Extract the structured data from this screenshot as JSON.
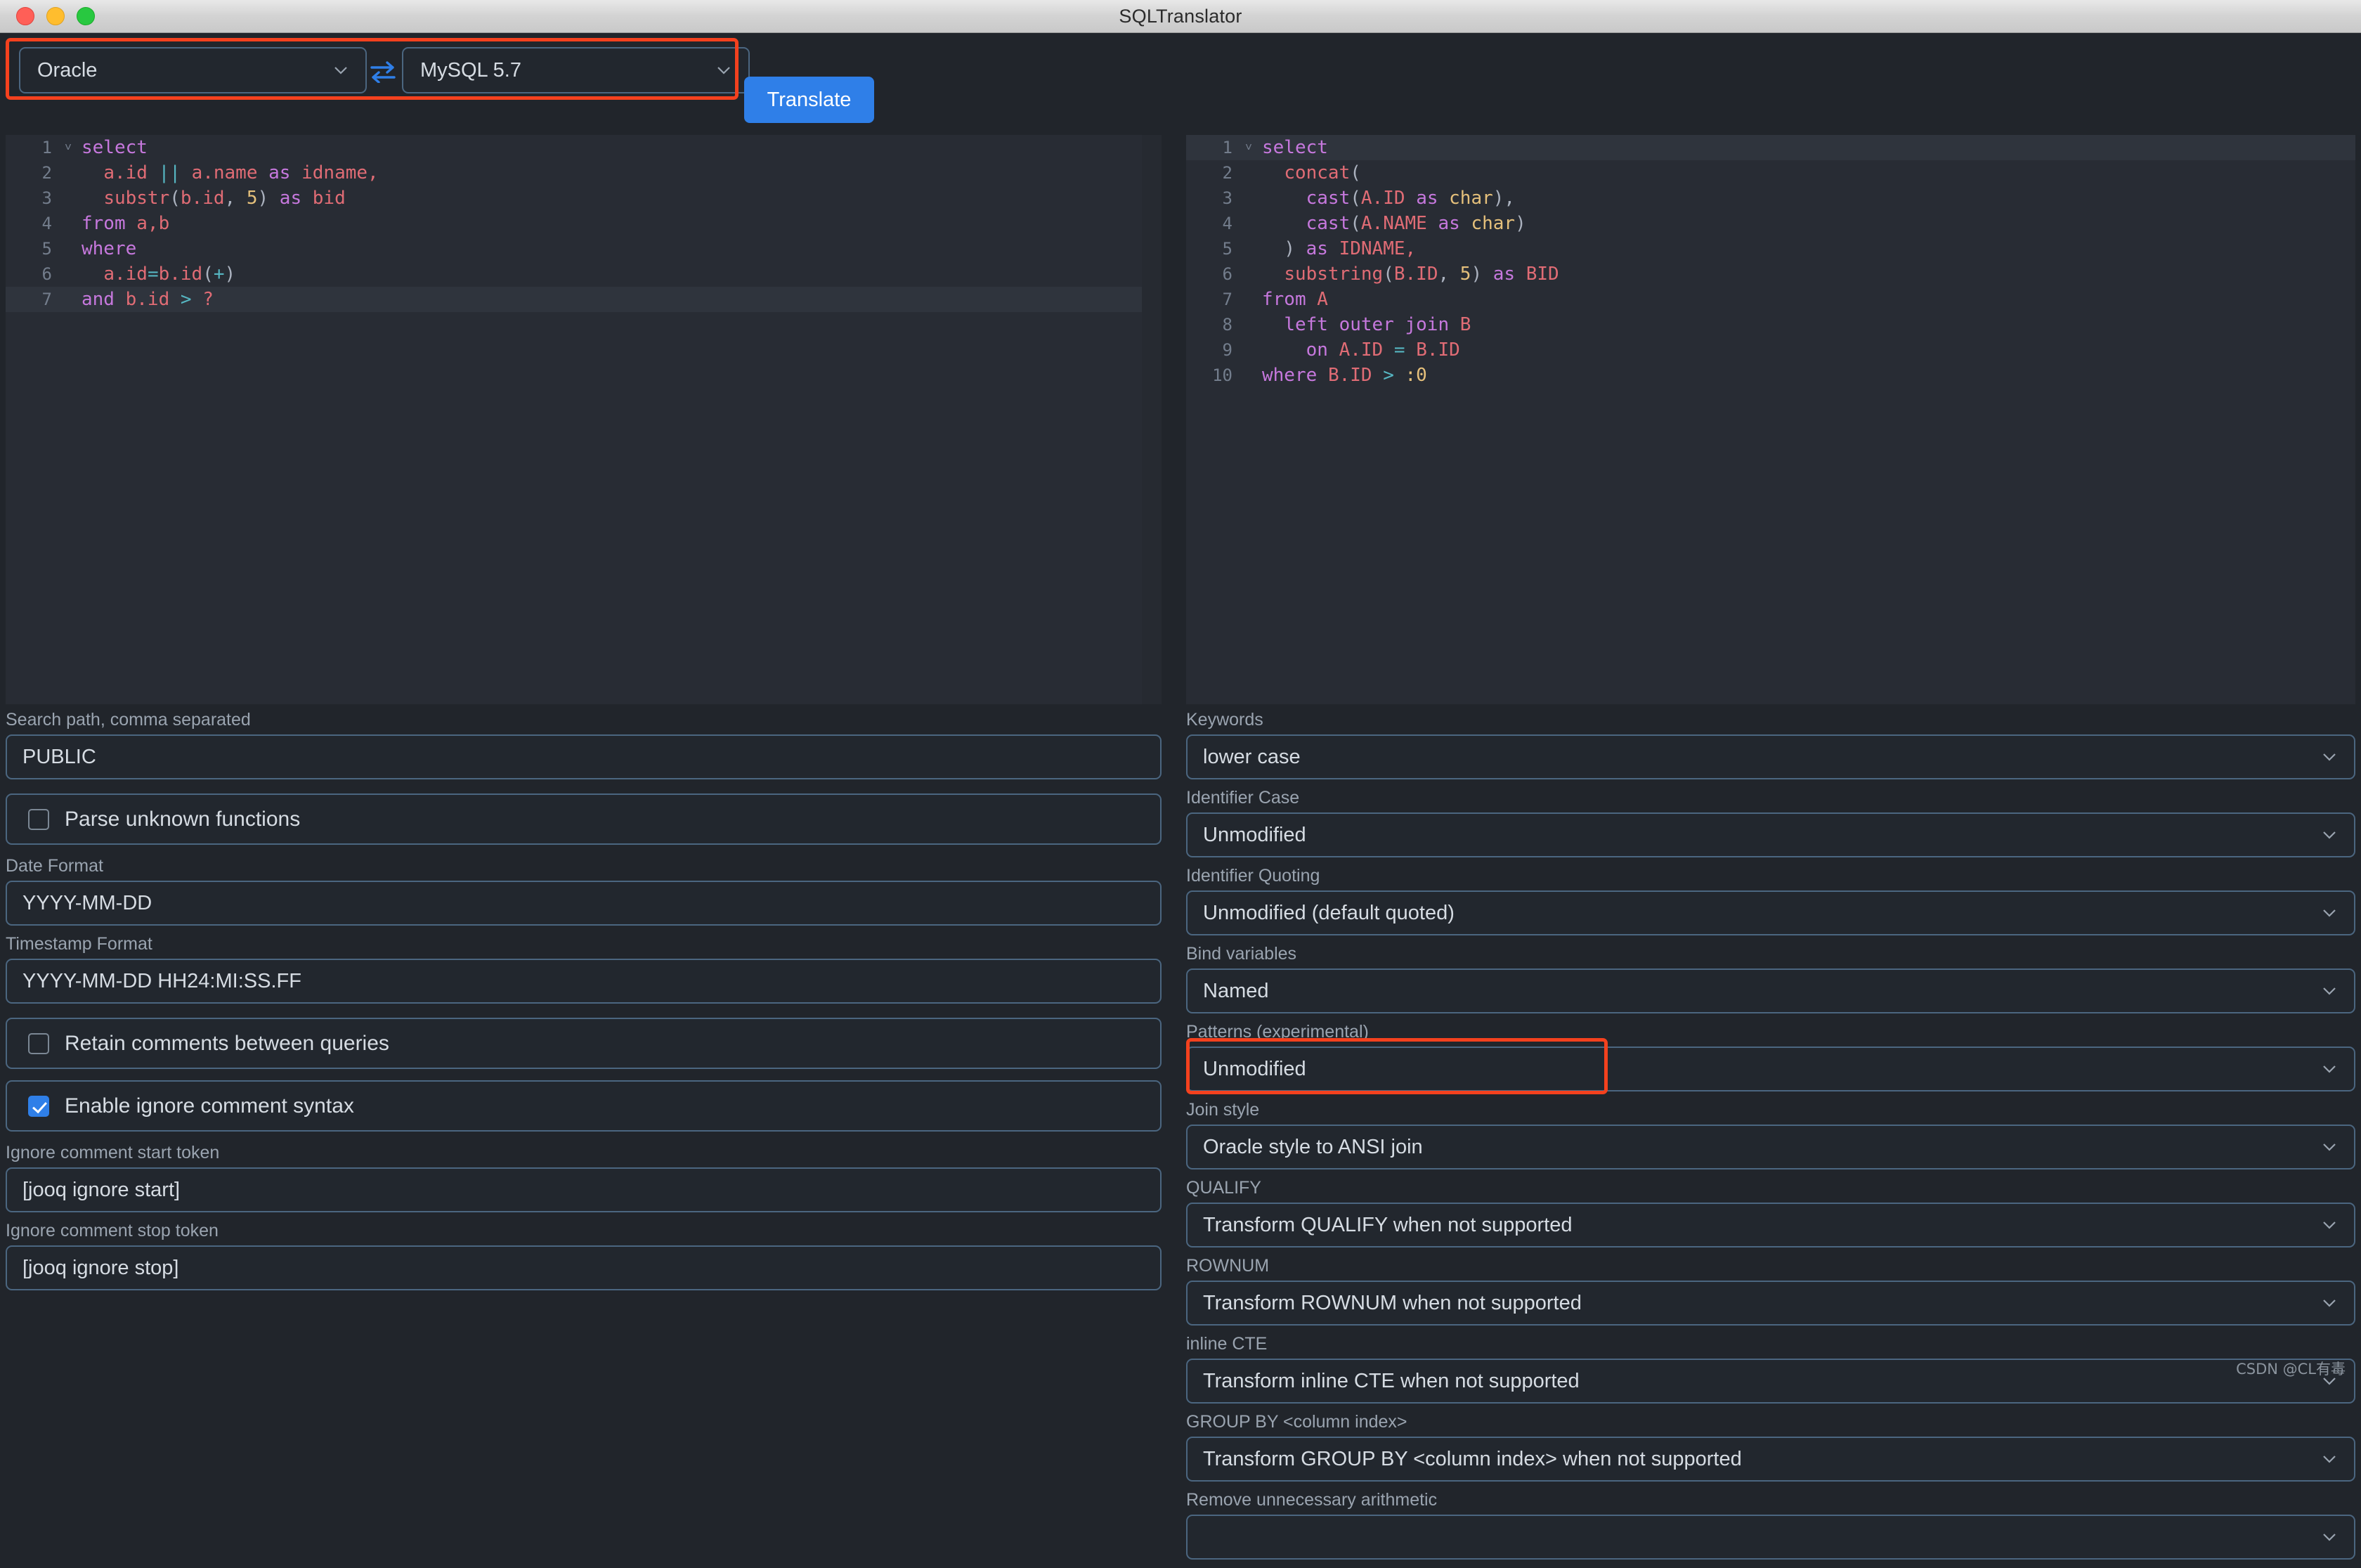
{
  "window": {
    "title": "SQLTranslator",
    "traffic_lights": [
      "close",
      "minimize",
      "maximize"
    ]
  },
  "toolbar": {
    "source_dialect": "Oracle",
    "target_dialect": "MySQL 5.7",
    "swap_icon": "swap-arrows-icon",
    "translate_label": "Translate",
    "highlighted": true
  },
  "accent": {
    "highlight_red": "#f4411e",
    "button_blue": "#2f7fe8",
    "border_blue": "#4b6680",
    "editor_bg": "#282c34",
    "app_bg": "#21252b"
  },
  "editor_left": {
    "active_line": 7,
    "lines": [
      {
        "n": 1,
        "fold": true,
        "tokens": [
          {
            "t": "select",
            "c": "kw"
          }
        ]
      },
      {
        "n": 2,
        "fold": false,
        "tokens": [
          {
            "t": "  ",
            "c": "pn"
          },
          {
            "t": "a.id",
            "c": "id"
          },
          {
            "t": " ",
            "c": "pn"
          },
          {
            "t": "||",
            "c": "op"
          },
          {
            "t": " ",
            "c": "pn"
          },
          {
            "t": "a.name",
            "c": "id"
          },
          {
            "t": " ",
            "c": "pn"
          },
          {
            "t": "as",
            "c": "kw"
          },
          {
            "t": " ",
            "c": "pn"
          },
          {
            "t": "idname,",
            "c": "id"
          }
        ]
      },
      {
        "n": 3,
        "fold": false,
        "tokens": [
          {
            "t": "  ",
            "c": "pn"
          },
          {
            "t": "substr",
            "c": "fn"
          },
          {
            "t": "(",
            "c": "pn"
          },
          {
            "t": "b.id",
            "c": "id"
          },
          {
            "t": ", ",
            "c": "pn"
          },
          {
            "t": "5",
            "c": "num"
          },
          {
            "t": ")",
            "c": "pn"
          },
          {
            "t": " ",
            "c": "pn"
          },
          {
            "t": "as",
            "c": "kw"
          },
          {
            "t": " ",
            "c": "pn"
          },
          {
            "t": "bid",
            "c": "id"
          }
        ]
      },
      {
        "n": 4,
        "fold": false,
        "tokens": [
          {
            "t": "from",
            "c": "kw"
          },
          {
            "t": " ",
            "c": "pn"
          },
          {
            "t": "a,b",
            "c": "id"
          }
        ]
      },
      {
        "n": 5,
        "fold": false,
        "tokens": [
          {
            "t": "where",
            "c": "kw"
          }
        ]
      },
      {
        "n": 6,
        "fold": false,
        "tokens": [
          {
            "t": "  ",
            "c": "pn"
          },
          {
            "t": "a.id",
            "c": "id"
          },
          {
            "t": "=",
            "c": "op"
          },
          {
            "t": "b.id",
            "c": "id"
          },
          {
            "t": "(",
            "c": "pn"
          },
          {
            "t": "+",
            "c": "op"
          },
          {
            "t": ")",
            "c": "pn"
          }
        ]
      },
      {
        "n": 7,
        "fold": false,
        "tokens": [
          {
            "t": "and",
            "c": "kw"
          },
          {
            "t": " ",
            "c": "pn"
          },
          {
            "t": "b.id",
            "c": "id"
          },
          {
            "t": " ",
            "c": "pn"
          },
          {
            "t": ">",
            "c": "op"
          },
          {
            "t": " ",
            "c": "pn"
          },
          {
            "t": "?",
            "c": "id"
          }
        ]
      }
    ]
  },
  "editor_right": {
    "active_line": 1,
    "lines": [
      {
        "n": 1,
        "fold": true,
        "tokens": [
          {
            "t": "select",
            "c": "kw"
          }
        ]
      },
      {
        "n": 2,
        "fold": false,
        "tokens": [
          {
            "t": "  ",
            "c": "pn"
          },
          {
            "t": "concat",
            "c": "fn"
          },
          {
            "t": "(",
            "c": "pn"
          }
        ]
      },
      {
        "n": 3,
        "fold": false,
        "tokens": [
          {
            "t": "    ",
            "c": "pn"
          },
          {
            "t": "cast",
            "c": "kw"
          },
          {
            "t": "(",
            "c": "pn"
          },
          {
            "t": "A.ID",
            "c": "id"
          },
          {
            "t": " ",
            "c": "pn"
          },
          {
            "t": "as",
            "c": "kw"
          },
          {
            "t": " ",
            "c": "pn"
          },
          {
            "t": "char",
            "c": "ty"
          },
          {
            "t": "),",
            "c": "pn"
          }
        ]
      },
      {
        "n": 4,
        "fold": false,
        "tokens": [
          {
            "t": "    ",
            "c": "pn"
          },
          {
            "t": "cast",
            "c": "kw"
          },
          {
            "t": "(",
            "c": "pn"
          },
          {
            "t": "A.NAME",
            "c": "id"
          },
          {
            "t": " ",
            "c": "pn"
          },
          {
            "t": "as",
            "c": "kw"
          },
          {
            "t": " ",
            "c": "pn"
          },
          {
            "t": "char",
            "c": "ty"
          },
          {
            "t": ")",
            "c": "pn"
          }
        ]
      },
      {
        "n": 5,
        "fold": false,
        "tokens": [
          {
            "t": "  ",
            "c": "pn"
          },
          {
            "t": ")",
            "c": "pn"
          },
          {
            "t": " ",
            "c": "pn"
          },
          {
            "t": "as",
            "c": "kw"
          },
          {
            "t": " ",
            "c": "pn"
          },
          {
            "t": "IDNAME,",
            "c": "id"
          }
        ]
      },
      {
        "n": 6,
        "fold": false,
        "tokens": [
          {
            "t": "  ",
            "c": "pn"
          },
          {
            "t": "substring",
            "c": "fn"
          },
          {
            "t": "(",
            "c": "pn"
          },
          {
            "t": "B.ID",
            "c": "id"
          },
          {
            "t": ", ",
            "c": "pn"
          },
          {
            "t": "5",
            "c": "num"
          },
          {
            "t": ")",
            "c": "pn"
          },
          {
            "t": " ",
            "c": "pn"
          },
          {
            "t": "as",
            "c": "kw"
          },
          {
            "t": " ",
            "c": "pn"
          },
          {
            "t": "BID",
            "c": "id"
          }
        ]
      },
      {
        "n": 7,
        "fold": false,
        "tokens": [
          {
            "t": "from",
            "c": "kw"
          },
          {
            "t": " ",
            "c": "pn"
          },
          {
            "t": "A",
            "c": "id"
          }
        ]
      },
      {
        "n": 8,
        "fold": false,
        "tokens": [
          {
            "t": "  ",
            "c": "pn"
          },
          {
            "t": "left outer join",
            "c": "kw"
          },
          {
            "t": " ",
            "c": "pn"
          },
          {
            "t": "B",
            "c": "id"
          }
        ]
      },
      {
        "n": 9,
        "fold": false,
        "tokens": [
          {
            "t": "    ",
            "c": "pn"
          },
          {
            "t": "on",
            "c": "kw"
          },
          {
            "t": " ",
            "c": "pn"
          },
          {
            "t": "A.ID",
            "c": "id"
          },
          {
            "t": " ",
            "c": "pn"
          },
          {
            "t": "=",
            "c": "op"
          },
          {
            "t": " ",
            "c": "pn"
          },
          {
            "t": "B.ID",
            "c": "id"
          }
        ]
      },
      {
        "n": 10,
        "fold": false,
        "tokens": [
          {
            "t": "where",
            "c": "kw"
          },
          {
            "t": " ",
            "c": "pn"
          },
          {
            "t": "B.ID",
            "c": "id"
          },
          {
            "t": " ",
            "c": "pn"
          },
          {
            "t": ">",
            "c": "op"
          },
          {
            "t": " ",
            "c": "pn"
          },
          {
            "t": ":0",
            "c": "num"
          }
        ]
      }
    ]
  },
  "settings_left": {
    "search_path_label": "Search path, comma separated",
    "search_path_value": "PUBLIC",
    "parse_unknown_functions_label": "Parse unknown functions",
    "parse_unknown_functions_checked": false,
    "date_format_label": "Date Format",
    "date_format_value": "YYYY-MM-DD",
    "timestamp_format_label": "Timestamp Format",
    "timestamp_format_value": "YYYY-MM-DD HH24:MI:SS.FF",
    "retain_comments_label": "Retain comments between queries",
    "retain_comments_checked": false,
    "enable_ignore_comment_label": "Enable ignore comment syntax",
    "enable_ignore_comment_checked": true,
    "ignore_start_label": "Ignore comment start token",
    "ignore_start_value": "[jooq ignore start]",
    "ignore_stop_label": "Ignore comment stop token",
    "ignore_stop_value": "[jooq ignore stop]"
  },
  "settings_right": {
    "keywords_label": "Keywords",
    "keywords_value": "lower case",
    "identifier_case_label": "Identifier Case",
    "identifier_case_value": "Unmodified",
    "identifier_quoting_label": "Identifier Quoting",
    "identifier_quoting_value": "Unmodified (default quoted)",
    "bind_variables_label": "Bind variables",
    "bind_variables_value": "Named",
    "patterns_label": "Patterns (experimental)",
    "patterns_value": "Unmodified",
    "join_style_label": "Join style",
    "join_style_value": "Oracle style to ANSI join",
    "join_style_highlighted": true,
    "qualify_label": "QUALIFY",
    "qualify_value": "Transform QUALIFY when not supported",
    "rownum_label": "ROWNUM",
    "rownum_value": "Transform ROWNUM when not supported",
    "inline_cte_label": "inline CTE",
    "inline_cte_value": "Transform inline CTE when not supported",
    "group_by_label": "GROUP BY <column index>",
    "group_by_value": "Transform GROUP BY <column index> when not supported",
    "remove_arithmetic_label": "Remove unnecessary arithmetic"
  },
  "watermark": "CSDN @CL有毒"
}
